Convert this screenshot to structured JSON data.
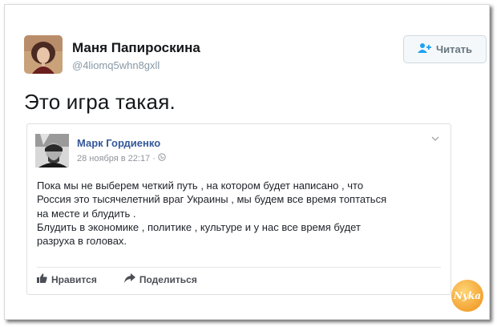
{
  "tweet": {
    "author_name": "Маня Папироскина",
    "author_handle": "@4liomq5whn8gxll",
    "follow_label": "Читать",
    "text": "Это игра такая."
  },
  "fb_post": {
    "author_name": "Марк Гордиенко",
    "meta_date": "28 ноября в 22:17",
    "body_lines": [
      "Пока мы не выберем четкий путь , на котором будет написано , что",
      "Россия это тысячелетний враг Украины , мы будем все время топтаться",
      "на месте и блудить .",
      "Блудить в экономике , политике , культуре и у нас все время будет",
      "разруха в головах."
    ],
    "like_label": "Нравится",
    "share_label": "Поделиться"
  },
  "watermark": {
    "text": "Nyka"
  },
  "colors": {
    "fb_link": "#365899",
    "twitter_gray": "#8899a6",
    "watermark_orange": "#f29a1e"
  }
}
